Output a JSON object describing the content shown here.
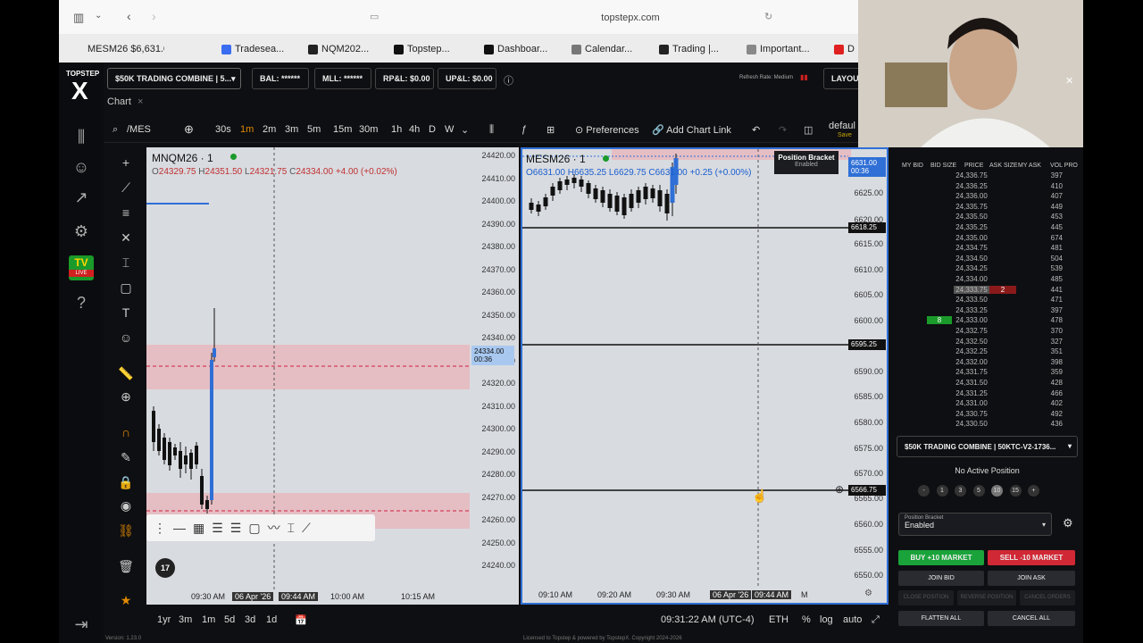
{
  "browser": {
    "url": "topstepx.com",
    "tabs": [
      {
        "label": "MESM26 $6,631.00...",
        "color": "#111"
      },
      {
        "label": "Tradesea...",
        "color": "#3a6df0"
      },
      {
        "label": "NQM202...",
        "color": "#222"
      },
      {
        "label": "Topstep...",
        "color": "#111"
      },
      {
        "label": "Dashboar...",
        "color": "#111"
      },
      {
        "label": "Calendar...",
        "color": "#777"
      },
      {
        "label": "Trading |...",
        "color": "#222"
      },
      {
        "label": "Important...",
        "color": "#888"
      },
      {
        "label": "D",
        "color": "#e02020"
      }
    ]
  },
  "brand": {
    "top": "TOPSTEP",
    "logo": "X",
    "tv_badge": "TV",
    "tv_sub": "LIVE"
  },
  "account": {
    "selector": "$50K TRADING COMBINE | 5...",
    "bal": "BAL: ******",
    "mll": "MLL: ******",
    "rpl": "RP&L: $0.00",
    "upl": "UP&L: $0.00",
    "refresh": "Refresh Rate: Medium",
    "layout": "LAYOUT"
  },
  "chart_tab": {
    "label": "Chart",
    "close": "×"
  },
  "toolbar": {
    "symbol": "/MES",
    "intervals": [
      "30s",
      "1m",
      "2m",
      "3m",
      "5m",
      "15m",
      "30m",
      "1h",
      "4h",
      "D",
      "W"
    ],
    "active_interval": "1m",
    "preferences": "Preferences",
    "add_chart_link": "Add Chart Link",
    "default_label": "defaul",
    "save_label": "Save"
  },
  "chart1": {
    "symbol": "MNQM26 · 1",
    "ohlc_o": "O",
    "ohlc_o_val": "24329.75",
    "ohlc_h": "H",
    "ohlc_h_val": "24351.50",
    "ohlc_l": "L",
    "ohlc_l_val": "24321.75",
    "ohlc_c": "C",
    "ohlc_c_val": "24334.00",
    "ohlc_chg": "+4.00 (+0.02%)",
    "prices": [
      "24420.00",
      "24410.00",
      "24400.00",
      "24390.00",
      "24380.00",
      "24370.00",
      "24360.00",
      "24350.00",
      "24340.00",
      "24330.00",
      "24320.00",
      "24310.00",
      "24300.00",
      "24290.00",
      "24280.00",
      "24270.00",
      "24260.00",
      "24250.00",
      "24240.00"
    ],
    "last_price": "24334.00",
    "last_time": "00:36",
    "times": [
      "09:30 AM",
      "06 Apr '26",
      "09:44 AM",
      "10:00 AM",
      "10:15 AM"
    ]
  },
  "chart2": {
    "symbol": "MESM26 · 1",
    "ohlc_o_val": "O6631.00",
    "ohlc_h_val": "H6635.25",
    "ohlc_l_val": "L6629.75",
    "ohlc_c_val": "C6631.00",
    "ohlc_chg": "+0.25 (+0.00%)",
    "bracket_title": "Position Bracket",
    "bracket_status": "Enabled",
    "last_price": "6631.00",
    "last_time": "00:36",
    "prices": [
      "6625.00",
      "6620.00",
      "6615.00",
      "6610.00",
      "6605.00",
      "6600.00",
      "6590.00",
      "6585.00",
      "6580.00",
      "6575.00",
      "6570.00",
      "6565.00",
      "6560.00",
      "6555.00",
      "6550.00"
    ],
    "hlines": [
      "6618.25",
      "6595.25",
      "6566.75"
    ],
    "times": [
      "09:10 AM",
      "09:20 AM",
      "09:30 AM",
      "06 Apr '26",
      "09:44 AM",
      "M"
    ]
  },
  "bottom": {
    "ranges": [
      "1yr",
      "3m",
      "1m",
      "5d",
      "3d",
      "1d"
    ],
    "clock": "09:31:22 AM (UTC-4)",
    "session": "ETH",
    "pct": "%",
    "log": "log",
    "auto": "auto"
  },
  "ladder": {
    "headers": [
      "MY BID",
      "BID SIZE",
      "PRICE",
      "ASK SIZE",
      "MY ASK",
      "VOL PRO"
    ],
    "rows": [
      {
        "price": "24,336.75",
        "vol": "397"
      },
      {
        "price": "24,336.25",
        "vol": "410"
      },
      {
        "price": "24,336.00",
        "vol": "407"
      },
      {
        "price": "24,335.75",
        "vol": "449"
      },
      {
        "price": "24,335.50",
        "vol": "453"
      },
      {
        "price": "24,335.25",
        "vol": "445"
      },
      {
        "price": "24,335.00",
        "vol": "674"
      },
      {
        "price": "24,334.75",
        "vol": "481"
      },
      {
        "price": "24,334.50",
        "vol": "504"
      },
      {
        "price": "24,334.25",
        "vol": "539"
      },
      {
        "price": "24,334.00",
        "vol": "485"
      },
      {
        "price": "24,333.75",
        "vol": "441",
        "ask": "2"
      },
      {
        "price": "24,333.50",
        "vol": "471"
      },
      {
        "price": "24,333.25",
        "vol": "397"
      },
      {
        "price": "24,333.00",
        "vol": "478",
        "bid": "8"
      },
      {
        "price": "24,332.75",
        "vol": "370"
      },
      {
        "price": "24,332.50",
        "vol": "327"
      },
      {
        "price": "24,332.25",
        "vol": "351"
      },
      {
        "price": "24,332.00",
        "vol": "398"
      },
      {
        "price": "24,331.75",
        "vol": "359"
      },
      {
        "price": "24,331.50",
        "vol": "428"
      },
      {
        "price": "24,331.25",
        "vol": "466"
      },
      {
        "price": "24,331.00",
        "vol": "402"
      },
      {
        "price": "24,330.75",
        "vol": "492"
      },
      {
        "price": "24,330.50",
        "vol": "436"
      }
    ]
  },
  "order": {
    "account": "$50K TRADING COMBINE | 50KTC-V2-1736...",
    "position": "No Active Position",
    "sizes": [
      "-",
      "1",
      "3",
      "5",
      "10",
      "15",
      "+"
    ],
    "bracket_label": "Position Bracket",
    "bracket_value": "Enabled",
    "buy": "BUY +10 MARKET",
    "sell": "SELL -10 MARKET",
    "join_bid": "JOIN BID",
    "join_ask": "JOIN ASK",
    "close_pos": "CLOSE POSITION",
    "reverse_pos": "REVERSE POSITION",
    "cancel_orders": "CANCEL ORDERS",
    "flatten": "FLATTEN ALL",
    "cancel_all": "CANCEL ALL"
  },
  "footer": {
    "version": "Version: 1.23.0",
    "license": "Licensed to Topstep & powered by TopstepX. Copyright 2024-2026"
  }
}
